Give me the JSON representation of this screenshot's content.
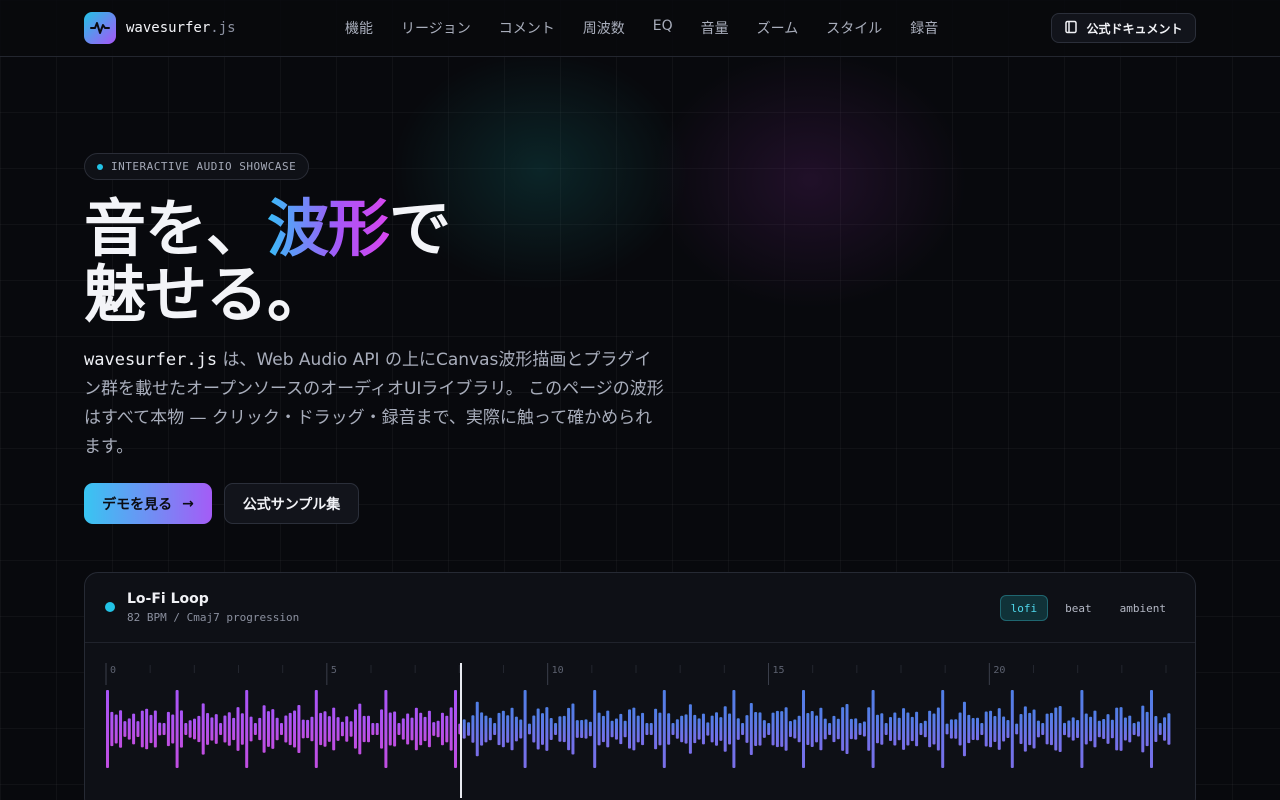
{
  "header": {
    "brand_name": "wavesurfer",
    "brand_ext": ".js",
    "nav": [
      "機能",
      "リージョン",
      "コメント",
      "周波数",
      "EQ",
      "音量",
      "ズーム",
      "スタイル",
      "録音"
    ],
    "docs_label": "公式ドキュメント"
  },
  "hero": {
    "badge": "INTERACTIVE AUDIO SHOWCASE",
    "headline_1": "音を、",
    "headline_accent": "波形",
    "headline_2": "で",
    "headline_3": "魅せる。",
    "lead_mono": "wavesurfer.js",
    "lead_text": " は、Web Audio API の上にCanvas波形描画とプラグイン群を載せたオープンソースのオーディオUIライブラリ。 このページの波形はすべて本物 — クリック・ドラッグ・録音まで、実際に触って確かめられます。",
    "cta_primary": "デモを見る",
    "cta_primary_arrow": "→",
    "cta_secondary": "公式サンプル集"
  },
  "player": {
    "track_title": "Lo-Fi Loop",
    "track_meta": "82 BPM / Cmaj7 progression",
    "presets": [
      {
        "label": "lofi",
        "active": true
      },
      {
        "label": "beat",
        "active": false
      },
      {
        "label": "ambient",
        "active": false
      }
    ],
    "timeline_labels": [
      "0",
      "5",
      "10",
      "15",
      "20"
    ],
    "timeline_max": 24,
    "progress": 0.33,
    "colors": {
      "played_start": "#a855f7",
      "played_end": "#c04ee0",
      "unplayed_start": "#4f7fe6",
      "unplayed_end": "#7a6ee8",
      "cursor": "#e8eaf0"
    }
  }
}
